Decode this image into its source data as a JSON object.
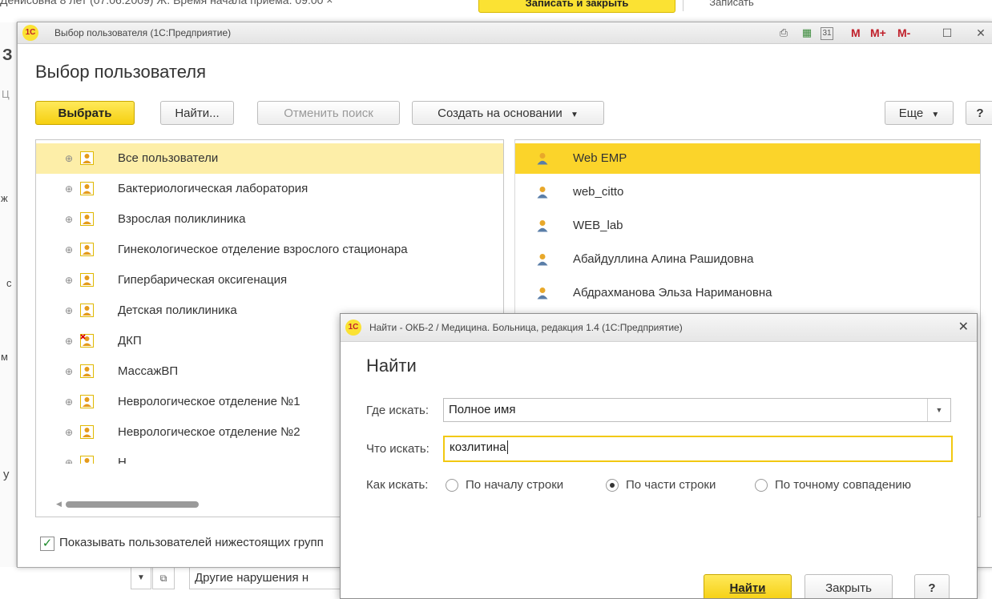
{
  "background": {
    "top_text": "Денисовна 8 лет (07.06.2009) Ж. Время начала приема: 09:00",
    "top_close": "×",
    "yellow_button": "Записать и закрыть",
    "top_button": "Записать",
    "edge_letters": [
      "З",
      "Ц",
      "ж",
      "с",
      "м",
      "у"
    ],
    "bottom_field": "Другие нарушения н"
  },
  "main_window": {
    "title": "Выбор пользователя  (1С:Предприятие)",
    "logo": "1С",
    "toolbar_m": [
      "M",
      "M+",
      "M-"
    ],
    "heading": "Выбор пользователя",
    "buttons": {
      "select": "Выбрать",
      "find": "Найти...",
      "cancel_search": "Отменить поиск",
      "create_based": "Создать на основании",
      "more": "Еще",
      "help": "?"
    },
    "groups": [
      "Все пользователи",
      "Бактериологическая лаборатория",
      "Взрослая поликлиника",
      "Гинекологическое отделение взрослого стационара",
      "Гипербарическая оксигенация",
      "Детская поликлиника",
      "ДКП",
      "МассажВП",
      "Неврологическое отделение №1",
      "Неврологическое отделение №2",
      "Н..."
    ],
    "users": [
      "Web EMP",
      "web_citto",
      "WEB_lab",
      "Абайдуллина Алина Рашидовна",
      "Абдрахманова Эльза Наримановна"
    ],
    "show_subordinate_label": "Показывать пользователей нижестоящих групп"
  },
  "find_dialog": {
    "title": "Найти - ОКБ-2 / Медицина. Больница, редакция 1.4  (1С:Предприятие)",
    "heading": "Найти",
    "where_label": "Где искать:",
    "where_value": "Полное имя",
    "what_label": "Что искать:",
    "what_value": "козлитина",
    "how_label": "Как искать:",
    "options": [
      "По началу строки",
      "По части строки",
      "По точному совпадению"
    ],
    "selected_option": "По части строки",
    "find_button": "Найти",
    "close_button": "Закрыть",
    "help_button": "?"
  },
  "colors": {
    "accent_yellow": "#fbd42a",
    "selection_light": "#fdeea8",
    "brand_red": "#c0202b"
  }
}
